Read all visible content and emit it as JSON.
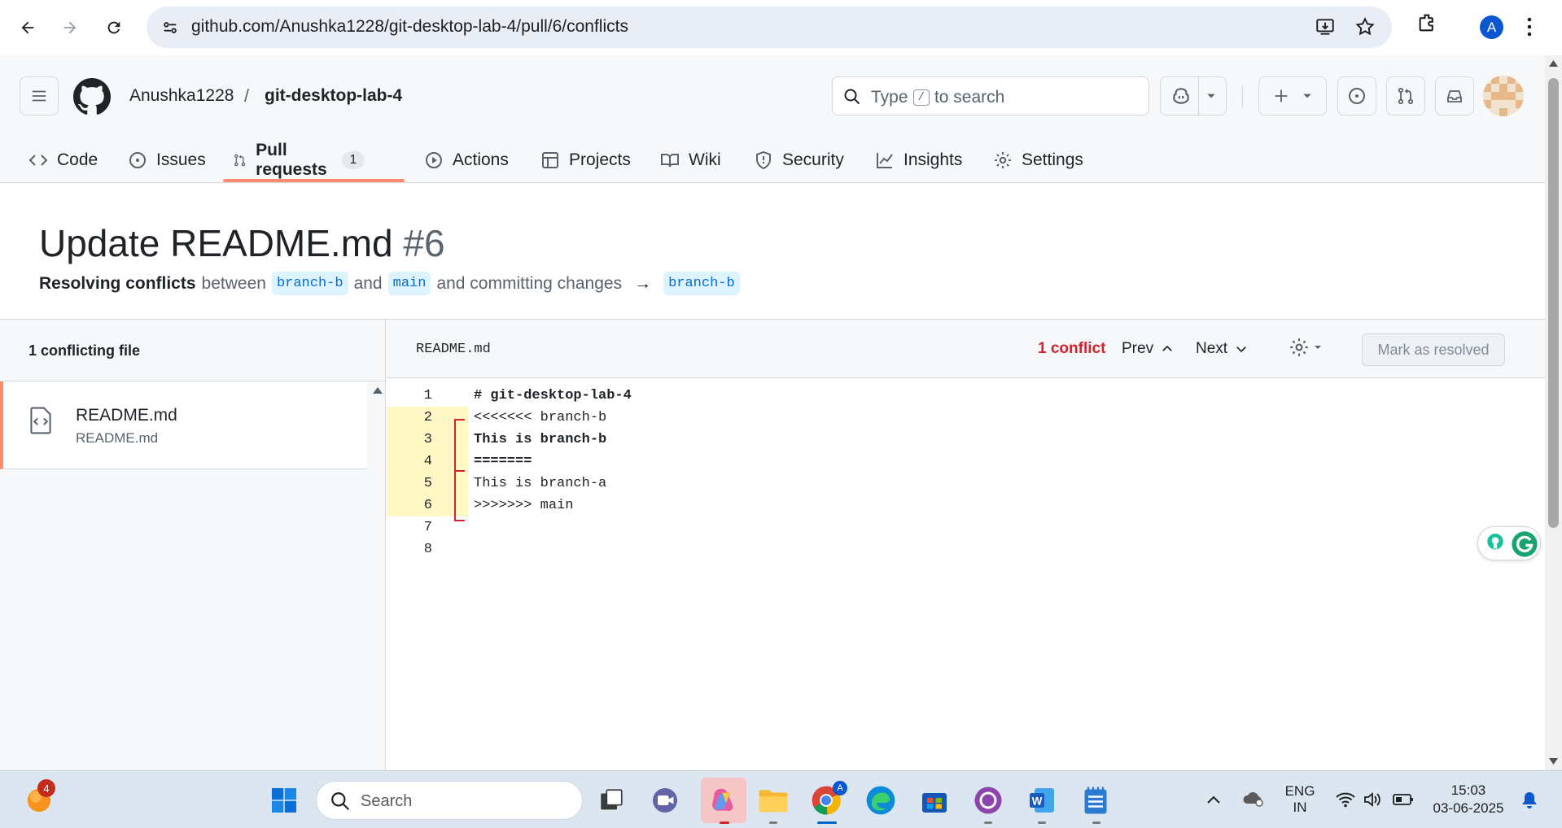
{
  "browser": {
    "url": "github.com/Anushka1228/git-desktop-lab-4/pull/6/conflicts",
    "profile_initial": "A"
  },
  "header": {
    "owner": "Anushka1228",
    "separator": "/",
    "repo": "git-desktop-lab-4",
    "search_prefix": "Type",
    "search_key": "/",
    "search_suffix": "to search"
  },
  "tabs": [
    {
      "label": "Code",
      "icon": "code-icon"
    },
    {
      "label": "Issues",
      "icon": "issue-icon"
    },
    {
      "label": "Pull requests",
      "icon": "pull-request-icon",
      "count": "1",
      "active": true
    },
    {
      "label": "Actions",
      "icon": "play-icon"
    },
    {
      "label": "Projects",
      "icon": "table-icon"
    },
    {
      "label": "Wiki",
      "icon": "book-icon"
    },
    {
      "label": "Security",
      "icon": "shield-icon"
    },
    {
      "label": "Insights",
      "icon": "graph-icon"
    },
    {
      "label": "Settings",
      "icon": "gear-icon"
    }
  ],
  "pr": {
    "title": "Update README.md",
    "number": "#6",
    "sub_bold": "Resolving conflicts",
    "sub_between": "between",
    "head_branch": "branch-b",
    "sub_and": "and",
    "base_branch": "main",
    "sub_committing": "and committing changes",
    "arrow": "→",
    "target_branch": "branch-b"
  },
  "sidebar": {
    "heading": "1 conflicting file",
    "files": [
      {
        "name": "README.md",
        "path": "README.md"
      }
    ]
  },
  "editor": {
    "filename": "README.md",
    "conflict_count": "1 conflict",
    "prev_label": "Prev",
    "next_label": "Next",
    "mark_resolved_label": "Mark as resolved",
    "lines": [
      {
        "num": "1",
        "text": "# git-desktop-lab-4",
        "bold": true,
        "conflict": false
      },
      {
        "num": "2",
        "text": "<<<<<<< branch-b",
        "bold": false,
        "conflict": true
      },
      {
        "num": "3",
        "text": "This is branch-b",
        "bold": true,
        "conflict": true
      },
      {
        "num": "4",
        "text": "=======",
        "bold": true,
        "conflict": true
      },
      {
        "num": "5",
        "text": "This is branch-a",
        "bold": false,
        "conflict": true
      },
      {
        "num": "6",
        "text": ">>>>>>> main",
        "bold": false,
        "conflict": true
      },
      {
        "num": "7",
        "text": "",
        "bold": false,
        "conflict": false
      },
      {
        "num": "8",
        "text": "",
        "bold": false,
        "conflict": false
      }
    ]
  },
  "taskbar": {
    "search_placeholder": "Search",
    "notification_badge": "4",
    "lang_top": "ENG",
    "lang_bottom": "IN",
    "time": "15:03",
    "date": "03-06-2025"
  },
  "colors": {
    "accent_underline": "#fd8c73",
    "conflict_red": "#d1242f",
    "conflict_highlight": "#fff8c5",
    "branch_label_bg": "#ddf4ff",
    "branch_label_fg": "#0969da"
  }
}
